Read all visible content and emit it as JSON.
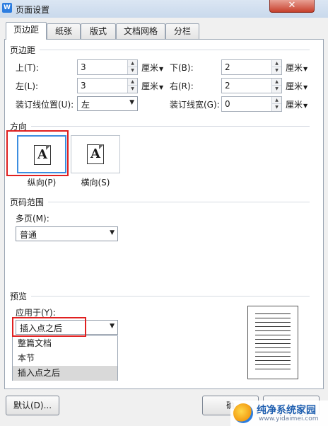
{
  "window": {
    "title": "页面设置",
    "app_icon": "W",
    "close_label": "✕"
  },
  "tabs": [
    {
      "label": "页边距",
      "active": true
    },
    {
      "label": "纸张"
    },
    {
      "label": "版式"
    },
    {
      "label": "文档网格"
    },
    {
      "label": "分栏"
    }
  ],
  "margins": {
    "group_title": "页边距",
    "top": {
      "label": "上(T):",
      "value": "3",
      "unit": "厘米"
    },
    "bottom": {
      "label": "下(B):",
      "value": "2",
      "unit": "厘米"
    },
    "left": {
      "label": "左(L):",
      "value": "3",
      "unit": "厘米"
    },
    "right": {
      "label": "右(R):",
      "value": "2",
      "unit": "厘米"
    },
    "gutter_pos": {
      "label": "装订线位置(U):",
      "value": "左"
    },
    "gutter_width": {
      "label": "装订线宽(G):",
      "value": "0",
      "unit": "厘米"
    }
  },
  "orientation": {
    "group_title": "方向",
    "portrait": {
      "label": "纵向(P)",
      "glyph": "A"
    },
    "landscape": {
      "label": "横向(S)",
      "glyph": "A"
    }
  },
  "page_range": {
    "group_title": "页码范围",
    "multi_label": "多页(M):",
    "multi_value": "普通"
  },
  "preview": {
    "group_title": "预览",
    "apply_label": "应用于(Y):",
    "apply_value": "插入点之后",
    "options": [
      "整篇文档",
      "本节",
      "插入点之后"
    ]
  },
  "buttons": {
    "default": "默认(D)...",
    "ok": "确"
  },
  "watermark": {
    "title": "纯净系统家园",
    "url": "www.yidaimei.com"
  },
  "colors": {
    "highlight": "#e02020",
    "selected_border": "#3d8ee0"
  }
}
